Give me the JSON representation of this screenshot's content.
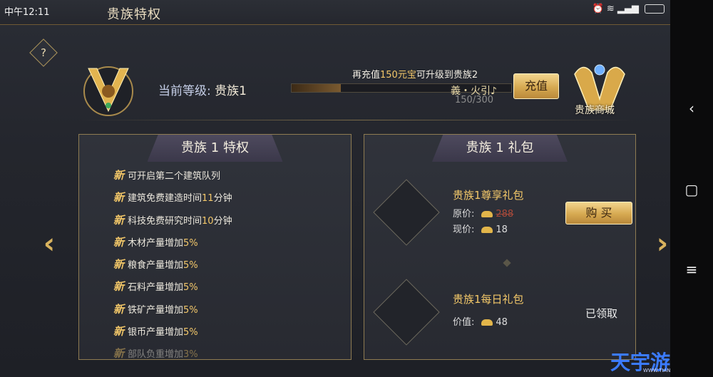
{
  "status": {
    "time": "中午12:11"
  },
  "header": {
    "title": "贵族特权",
    "help": "?"
  },
  "level": {
    "label": "当前等级:",
    "value": "贵族1",
    "tip_prefix": "再充值",
    "tip_amount": "150元宝",
    "tip_suffix": "可升级到贵族2",
    "progress_text": "150/300",
    "progress_fraction": 0.5,
    "overlay": "義・火引♪",
    "recharge_label": "充值",
    "shop_label": "贵族商城"
  },
  "privileges": {
    "title": "贵族 1 特权",
    "new_mark": "新",
    "items": [
      {
        "pre": "可开启第二个建筑队列",
        "num": "",
        "post": ""
      },
      {
        "pre": "建筑免费建造时间",
        "num": "11",
        "post": "分钟"
      },
      {
        "pre": "科技免费研究时间",
        "num": "10",
        "post": "分钟"
      },
      {
        "pre": "木材产量增加",
        "num": "5%",
        "post": ""
      },
      {
        "pre": "粮食产量增加",
        "num": "5%",
        "post": ""
      },
      {
        "pre": "石料产量增加",
        "num": "5%",
        "post": ""
      },
      {
        "pre": "铁矿产量增加",
        "num": "5%",
        "post": ""
      },
      {
        "pre": "银币产量增加",
        "num": "5%",
        "post": ""
      },
      {
        "pre": "部队负重增加",
        "num": "3%",
        "post": ""
      }
    ]
  },
  "gifts": {
    "title": "贵族 1 礼包",
    "exclusive": {
      "name": "贵族1尊享礼包",
      "orig_label": "原价:",
      "orig_price": "288",
      "now_label": "现价:",
      "now_price": "18",
      "buy_label": "购 买"
    },
    "daily": {
      "name": "贵族1每日礼包",
      "value_label": "价值:",
      "value": "48",
      "claimed_label": "已领取"
    }
  },
  "arrows": {
    "left": "‹",
    "right": "›"
  },
  "watermark": {
    "brand": "天宇游",
    "url": "WWW.TIANYUYOU.CN"
  },
  "colors": {
    "gold": "#f4c86a",
    "panel_border": "#8e7b52",
    "accent_blue": "#3b7bff"
  }
}
